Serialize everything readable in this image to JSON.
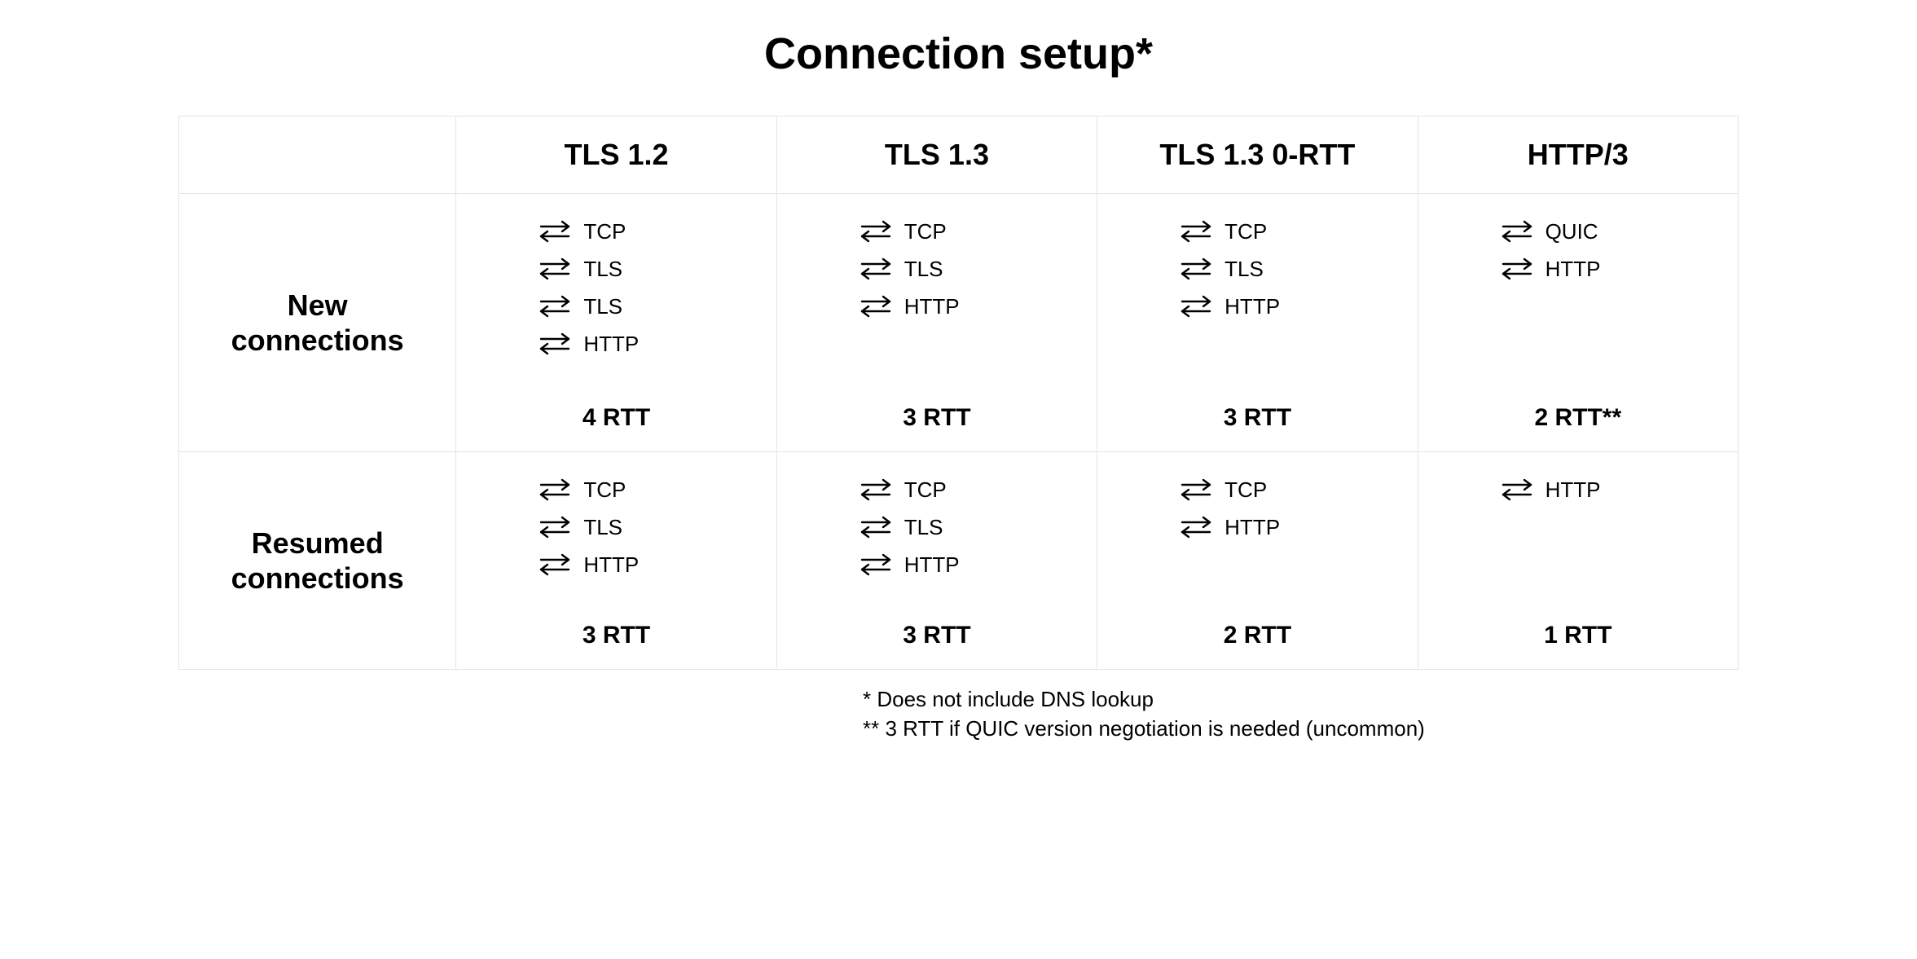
{
  "title": "Connection setup*",
  "columns": [
    "TLS 1.2",
    "TLS 1.3",
    "TLS 1.3 0-RTT",
    "HTTP/3"
  ],
  "rows": {
    "new": {
      "label": "New connections",
      "cells": [
        {
          "steps": [
            "TCP",
            "TLS",
            "TLS",
            "HTTP"
          ],
          "rtt": "4 RTT"
        },
        {
          "steps": [
            "TCP",
            "TLS",
            "HTTP"
          ],
          "rtt": "3 RTT"
        },
        {
          "steps": [
            "TCP",
            "TLS",
            "HTTP"
          ],
          "rtt": "3 RTT"
        },
        {
          "steps": [
            "QUIC",
            "HTTP"
          ],
          "rtt": "2 RTT**"
        }
      ]
    },
    "resumed": {
      "label": "Resumed connections",
      "cells": [
        {
          "steps": [
            "TCP",
            "TLS",
            "HTTP"
          ],
          "rtt": "3 RTT"
        },
        {
          "steps": [
            "TCP",
            "TLS",
            "HTTP"
          ],
          "rtt": "3 RTT"
        },
        {
          "steps": [
            "TCP",
            "HTTP"
          ],
          "rtt": "2 RTT"
        },
        {
          "steps": [
            "HTTP"
          ],
          "rtt": "1 RTT"
        }
      ]
    }
  },
  "footnotes": [
    "* Does not include DNS lookup",
    "** 3 RTT if QUIC version negotiation is needed (uncommon)"
  ]
}
